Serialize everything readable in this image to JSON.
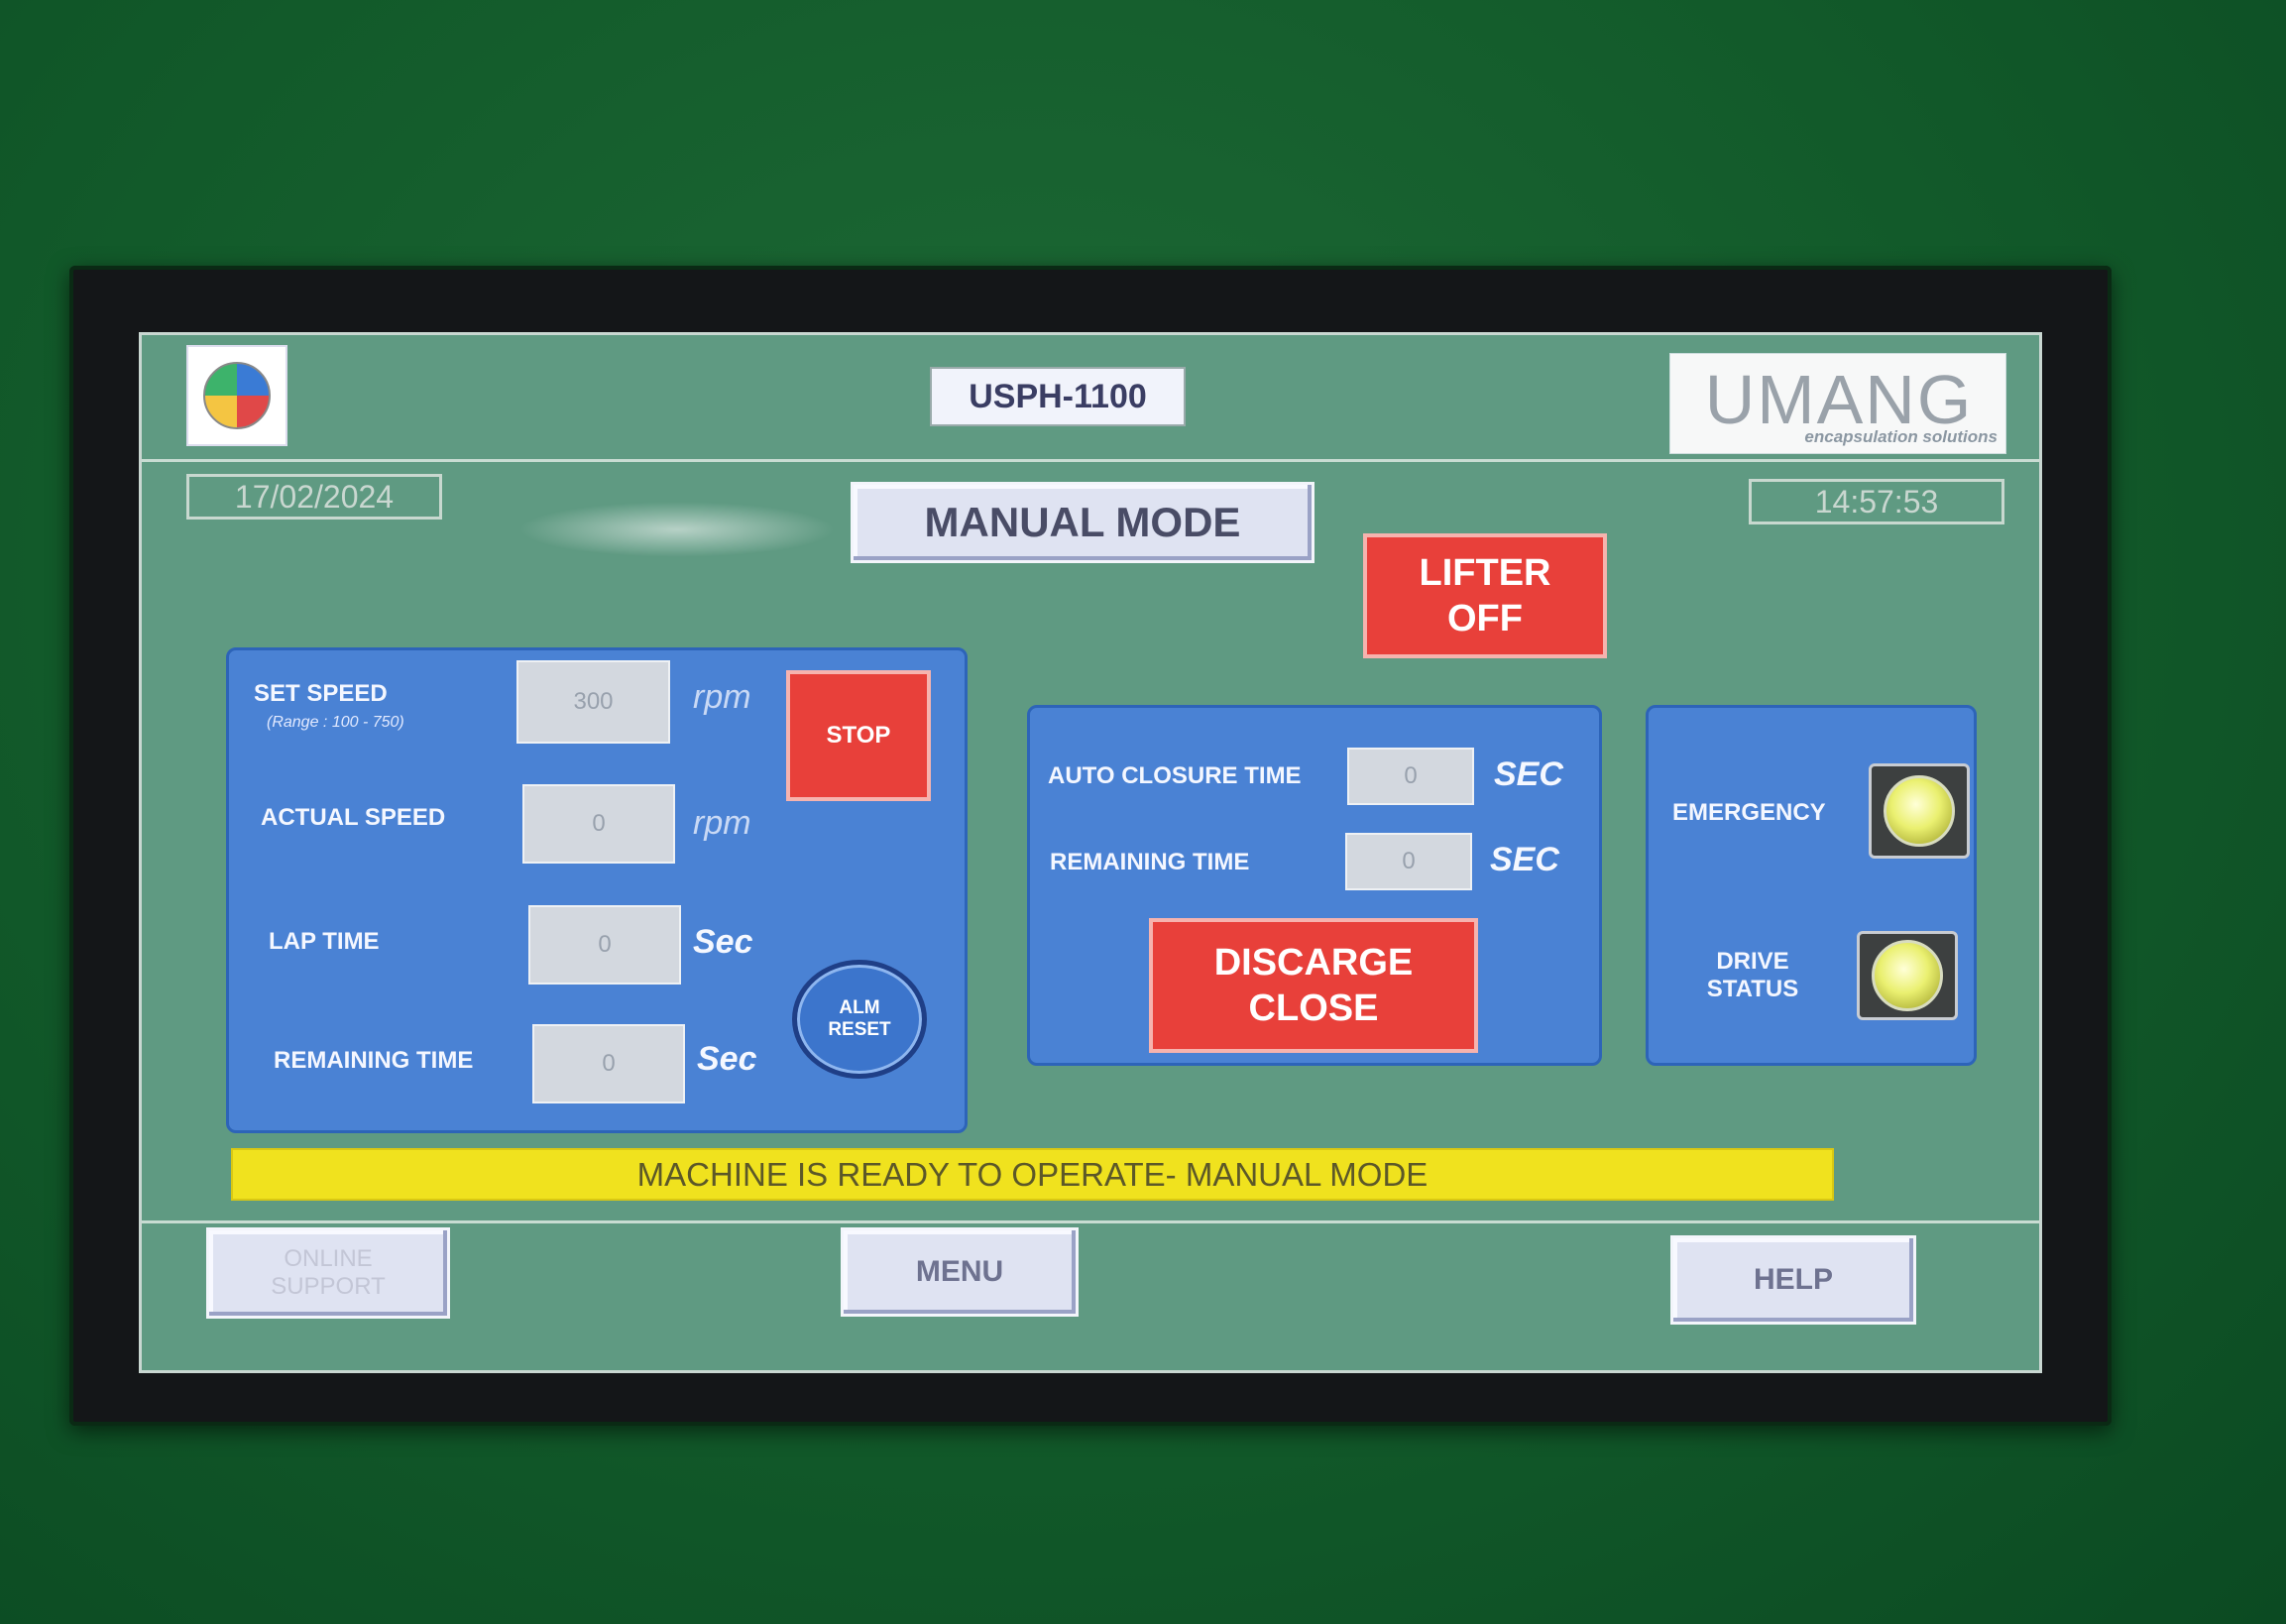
{
  "header": {
    "model": "USPH-1100",
    "brand_name": "UMANG",
    "brand_tagline": "encapsulation solutions"
  },
  "datetime": {
    "date": "17/02/2024",
    "time": "14:57:53"
  },
  "mode_title": "MANUAL MODE",
  "lifter_button": {
    "line1": "LIFTER",
    "line2": "OFF"
  },
  "speed_panel": {
    "set_speed_label": "SET SPEED",
    "set_speed_range": "(Range : 100 - 750)",
    "set_speed_value": "300",
    "set_speed_unit": "rpm",
    "actual_speed_label": "ACTUAL SPEED",
    "actual_speed_value": "0",
    "actual_speed_unit": "rpm",
    "lap_time_label": "LAP TIME",
    "lap_time_value": "0",
    "lap_time_unit": "Sec",
    "remaining_time_label": "REMAINING TIME",
    "remaining_time_value": "0",
    "remaining_time_unit": "Sec",
    "stop_label": "STOP",
    "alm_line1": "ALM",
    "alm_line2": "RESET"
  },
  "closure_panel": {
    "auto_closure_label": "AUTO CLOSURE TIME",
    "auto_closure_value": "0",
    "auto_closure_unit": "SEC",
    "remaining_label": "REMAINING TIME",
    "remaining_value": "0",
    "remaining_unit": "SEC",
    "discharge_line1": "DISCARGE",
    "discharge_line2": "CLOSE"
  },
  "status_panel": {
    "emergency_label": "EMERGENCY",
    "drive_line1": "DRIVE",
    "drive_line2": "STATUS"
  },
  "status_message": "MACHINE IS READY TO OPERATE- MANUAL MODE",
  "footer": {
    "online_line1": "ONLINE",
    "online_line2": "SUPPORT",
    "menu": "MENU",
    "help": "HELP"
  },
  "colors": {
    "screen_bg": "#5f9a82",
    "panel_blue": "#4a82d4",
    "alarm_red": "#e8403a",
    "status_yellow": "#f0e21e",
    "lamp_yellow": "#eaf070"
  }
}
